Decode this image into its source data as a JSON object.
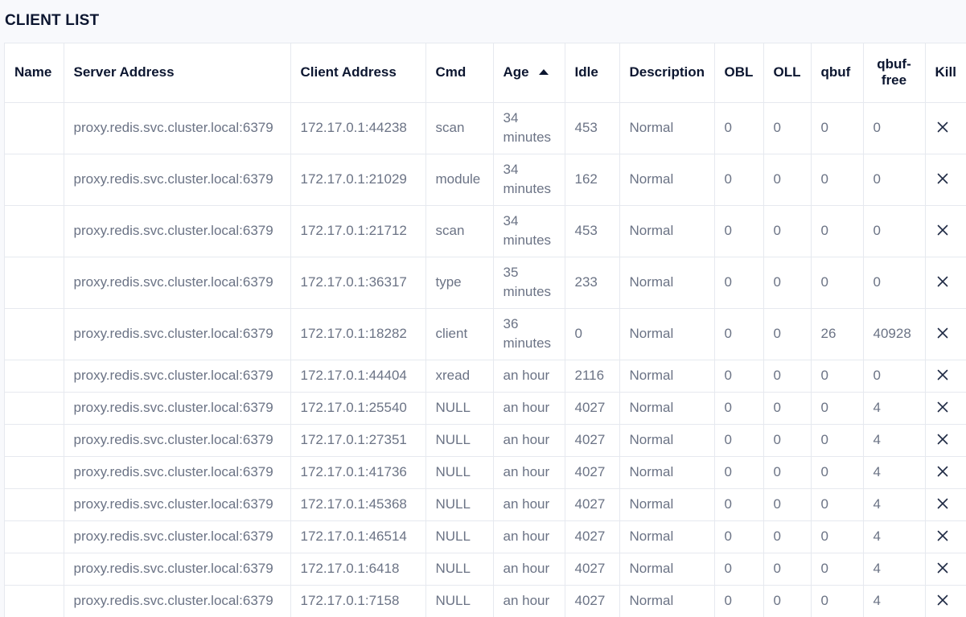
{
  "title": "CLIENT LIST",
  "columns": [
    {
      "key": "name",
      "label": "Name"
    },
    {
      "key": "server",
      "label": "Server Address"
    },
    {
      "key": "client",
      "label": "Client Address"
    },
    {
      "key": "cmd",
      "label": "Cmd"
    },
    {
      "key": "age",
      "label": "Age"
    },
    {
      "key": "idle",
      "label": "Idle"
    },
    {
      "key": "desc",
      "label": "Description"
    },
    {
      "key": "obl",
      "label": "OBL"
    },
    {
      "key": "oll",
      "label": "OLL"
    },
    {
      "key": "qbuf",
      "label": "qbuf"
    },
    {
      "key": "qbuffree",
      "label": "qbuf-free"
    },
    {
      "key": "kill",
      "label": "Kill"
    }
  ],
  "sort": {
    "column": "Age",
    "direction": "asc"
  },
  "rows": [
    {
      "name": "",
      "server": "proxy.redis.svc.cluster.local:6379",
      "client": "172.17.0.1:44238",
      "cmd": "scan",
      "age": "34 minutes",
      "idle": "453",
      "desc": "Normal",
      "obl": "0",
      "oll": "0",
      "qbuf": "0",
      "qbuffree": "0"
    },
    {
      "name": "",
      "server": "proxy.redis.svc.cluster.local:6379",
      "client": "172.17.0.1:21029",
      "cmd": "module",
      "age": "34 minutes",
      "idle": "162",
      "desc": "Normal",
      "obl": "0",
      "oll": "0",
      "qbuf": "0",
      "qbuffree": "0"
    },
    {
      "name": "",
      "server": "proxy.redis.svc.cluster.local:6379",
      "client": "172.17.0.1:21712",
      "cmd": "scan",
      "age": "34 minutes",
      "idle": "453",
      "desc": "Normal",
      "obl": "0",
      "oll": "0",
      "qbuf": "0",
      "qbuffree": "0"
    },
    {
      "name": "",
      "server": "proxy.redis.svc.cluster.local:6379",
      "client": "172.17.0.1:36317",
      "cmd": "type",
      "age": "35 minutes",
      "idle": "233",
      "desc": "Normal",
      "obl": "0",
      "oll": "0",
      "qbuf": "0",
      "qbuffree": "0"
    },
    {
      "name": "",
      "server": "proxy.redis.svc.cluster.local:6379",
      "client": "172.17.0.1:18282",
      "cmd": "client",
      "age": "36 minutes",
      "idle": "0",
      "desc": "Normal",
      "obl": "0",
      "oll": "0",
      "qbuf": "26",
      "qbuffree": "40928"
    },
    {
      "name": "",
      "server": "proxy.redis.svc.cluster.local:6379",
      "client": "172.17.0.1:44404",
      "cmd": "xread",
      "age": "an hour",
      "idle": "2116",
      "desc": "Normal",
      "obl": "0",
      "oll": "0",
      "qbuf": "0",
      "qbuffree": "0"
    },
    {
      "name": "",
      "server": "proxy.redis.svc.cluster.local:6379",
      "client": "172.17.0.1:25540",
      "cmd": "NULL",
      "age": "an hour",
      "idle": "4027",
      "desc": "Normal",
      "obl": "0",
      "oll": "0",
      "qbuf": "0",
      "qbuffree": "4"
    },
    {
      "name": "",
      "server": "proxy.redis.svc.cluster.local:6379",
      "client": "172.17.0.1:27351",
      "cmd": "NULL",
      "age": "an hour",
      "idle": "4027",
      "desc": "Normal",
      "obl": "0",
      "oll": "0",
      "qbuf": "0",
      "qbuffree": "4"
    },
    {
      "name": "",
      "server": "proxy.redis.svc.cluster.local:6379",
      "client": "172.17.0.1:41736",
      "cmd": "NULL",
      "age": "an hour",
      "idle": "4027",
      "desc": "Normal",
      "obl": "0",
      "oll": "0",
      "qbuf": "0",
      "qbuffree": "4"
    },
    {
      "name": "",
      "server": "proxy.redis.svc.cluster.local:6379",
      "client": "172.17.0.1:45368",
      "cmd": "NULL",
      "age": "an hour",
      "idle": "4027",
      "desc": "Normal",
      "obl": "0",
      "oll": "0",
      "qbuf": "0",
      "qbuffree": "4"
    },
    {
      "name": "",
      "server": "proxy.redis.svc.cluster.local:6379",
      "client": "172.17.0.1:46514",
      "cmd": "NULL",
      "age": "an hour",
      "idle": "4027",
      "desc": "Normal",
      "obl": "0",
      "oll": "0",
      "qbuf": "0",
      "qbuffree": "4"
    },
    {
      "name": "",
      "server": "proxy.redis.svc.cluster.local:6379",
      "client": "172.17.0.1:6418",
      "cmd": "NULL",
      "age": "an hour",
      "idle": "4027",
      "desc": "Normal",
      "obl": "0",
      "oll": "0",
      "qbuf": "0",
      "qbuffree": "4"
    },
    {
      "name": "",
      "server": "proxy.redis.svc.cluster.local:6379",
      "client": "172.17.0.1:7158",
      "cmd": "NULL",
      "age": "an hour",
      "idle": "4027",
      "desc": "Normal",
      "obl": "0",
      "oll": "0",
      "qbuf": "0",
      "qbuffree": "4"
    }
  ],
  "icons": {
    "kill": "close-icon",
    "sort": "sort-ascending-icon"
  },
  "colors": {
    "header_text": "#0c1630",
    "cell_text": "#6b7385",
    "border": "#e6e9ef",
    "page_bg": "#f8f9fc"
  }
}
